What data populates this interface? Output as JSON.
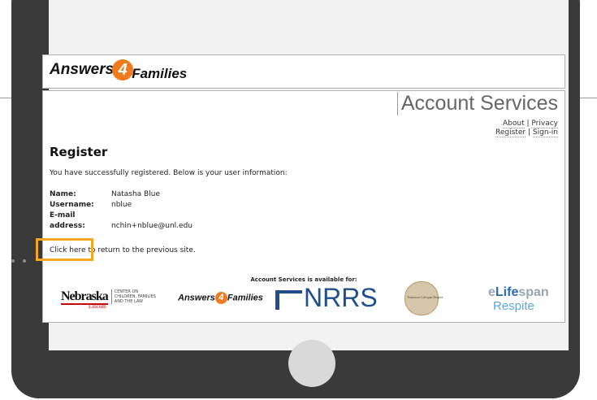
{
  "header": {
    "logo_part1": "Answers",
    "logo_four": "4",
    "logo_part2": "Families"
  },
  "page": {
    "title": "Account Services",
    "links_row1": [
      "About",
      "Privacy"
    ],
    "links_row2": [
      "Register",
      "Sign-in"
    ],
    "separator": "|",
    "heading": "Register",
    "message": "You have successfully registered. Below is your user information:",
    "fields": [
      {
        "label": "Name:",
        "value": "Natasha Blue"
      },
      {
        "label": "Username:",
        "value": "nblue"
      },
      {
        "label": "E-mail address:",
        "value": "nchin+nblue@unl.edu"
      }
    ],
    "return_link": "Click here",
    "return_text": " to return to the previous site.",
    "available_for": "Account Services is available for:"
  },
  "partners": {
    "unl_name": "Nebraska",
    "unl_sub": "Lincoln",
    "unl_center": "CENTER ON CHILDREN, FAMILIES AND THE LAW",
    "a4f_part1": "Answers",
    "a4f_four": "4",
    "a4f_part2": "Families",
    "nrrs": "NRRS",
    "seal_text": "Tennessee Lifespan Respite",
    "elifespan_e": "e",
    "elifespan_life": "Life",
    "elifespan_span": "span",
    "respite": "Respite"
  },
  "colors": {
    "highlight": "#f5a623",
    "a4f_orange": "#f07a1e",
    "nrrs_blue": "#1f4f8b"
  }
}
